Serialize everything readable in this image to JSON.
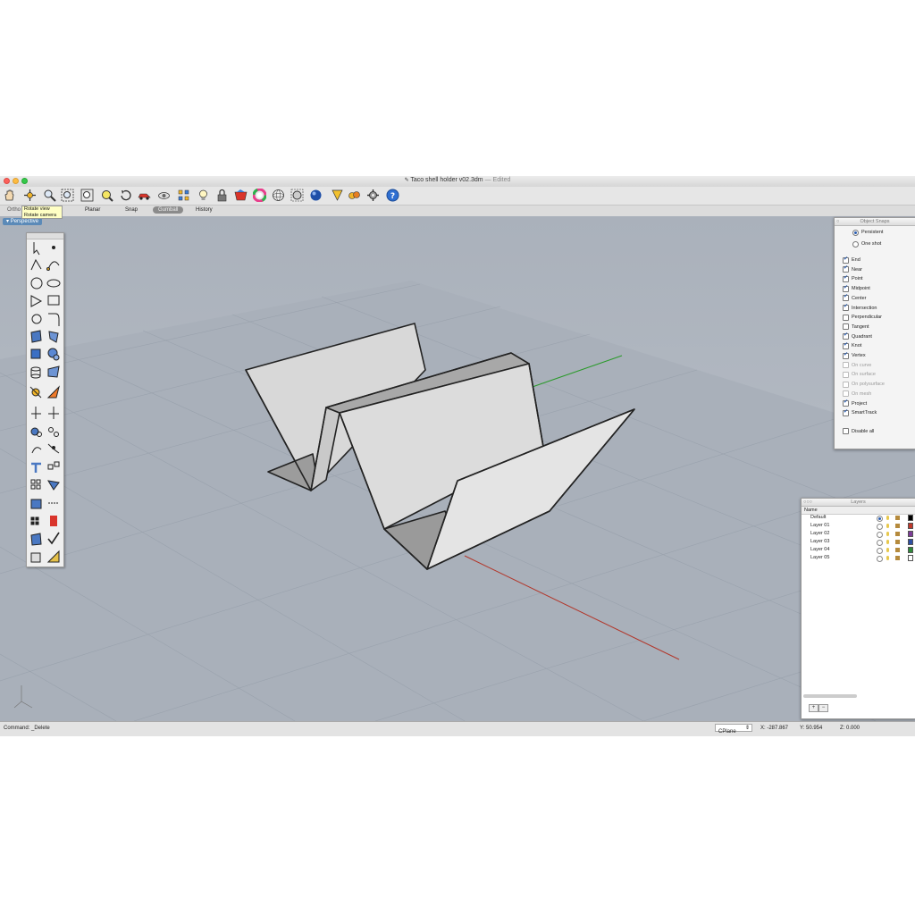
{
  "window": {
    "title": "Taco shell holder v02.3dm",
    "edited": "— Edited"
  },
  "toolbar": {
    "icons": [
      "pan-icon",
      "rotate-view-icon",
      "zoom-icon",
      "zoom-extents-icon",
      "zoom-window-icon",
      "zoom-selected-icon",
      "undo-view-icon",
      "car-icon",
      "hide-icon",
      "layer-state-icon",
      "light-icon",
      "lock-icon",
      "render-icon",
      "color-wheel-icon",
      "sphere-icon",
      "sphere-wire-icon",
      "material-icon",
      "flag-icon",
      "puzzle-icon",
      "options-icon",
      "help-icon"
    ]
  },
  "tabs": [
    {
      "label": "Ortho"
    },
    {
      "label": "Planar"
    },
    {
      "label": "Snap"
    },
    {
      "label": "Gumball",
      "active": true
    },
    {
      "label": "History"
    }
  ],
  "tooltip": {
    "line1": "Rotate view",
    "line2": "Rotate camera"
  },
  "viewport": {
    "label": "Perspective"
  },
  "object_snaps": {
    "title": "Object Snaps",
    "modes": [
      {
        "label": "Persistent",
        "selected": true
      },
      {
        "label": "One shot",
        "selected": false
      }
    ],
    "items": [
      {
        "label": "End",
        "checked": true,
        "enabled": true
      },
      {
        "label": "Near",
        "checked": true,
        "enabled": true
      },
      {
        "label": "Point",
        "checked": true,
        "enabled": true
      },
      {
        "label": "Midpoint",
        "checked": true,
        "enabled": true
      },
      {
        "label": "Center",
        "checked": true,
        "enabled": true
      },
      {
        "label": "Intersection",
        "checked": true,
        "enabled": true
      },
      {
        "label": "Perpendicular",
        "checked": false,
        "enabled": true
      },
      {
        "label": "Tangent",
        "checked": false,
        "enabled": true
      },
      {
        "label": "Quadrant",
        "checked": true,
        "enabled": true
      },
      {
        "label": "Knot",
        "checked": true,
        "enabled": true
      },
      {
        "label": "Vertex",
        "checked": true,
        "enabled": true
      },
      {
        "label": "On curve",
        "checked": false,
        "enabled": false
      },
      {
        "label": "On surface",
        "checked": false,
        "enabled": false
      },
      {
        "label": "On polysurface",
        "checked": false,
        "enabled": false
      },
      {
        "label": "On mesh",
        "checked": false,
        "enabled": false
      },
      {
        "label": "Project",
        "checked": true,
        "enabled": true
      },
      {
        "label": "SmartTrack",
        "checked": true,
        "enabled": true
      }
    ],
    "disable_all": "Disable all"
  },
  "layers": {
    "title": "Layers",
    "column_name": "Name",
    "rows": [
      {
        "name": "Default",
        "current": true,
        "color": "#000000"
      },
      {
        "name": "Layer 01",
        "current": false,
        "color": "#c0392b"
      },
      {
        "name": "Layer 02",
        "current": false,
        "color": "#7d3c98"
      },
      {
        "name": "Layer 03",
        "current": false,
        "color": "#2e4fa3"
      },
      {
        "name": "Layer 04",
        "current": false,
        "color": "#2f8a3a"
      },
      {
        "name": "Layer 05",
        "current": false,
        "color": "#ffffff"
      }
    ],
    "add_label": "+",
    "remove_label": "−"
  },
  "status": {
    "command": "Command: _Delete",
    "cplane": "CPlane",
    "x": "X: -287.867",
    "y": "Y: 50.954",
    "z": "Z: 0.000"
  }
}
